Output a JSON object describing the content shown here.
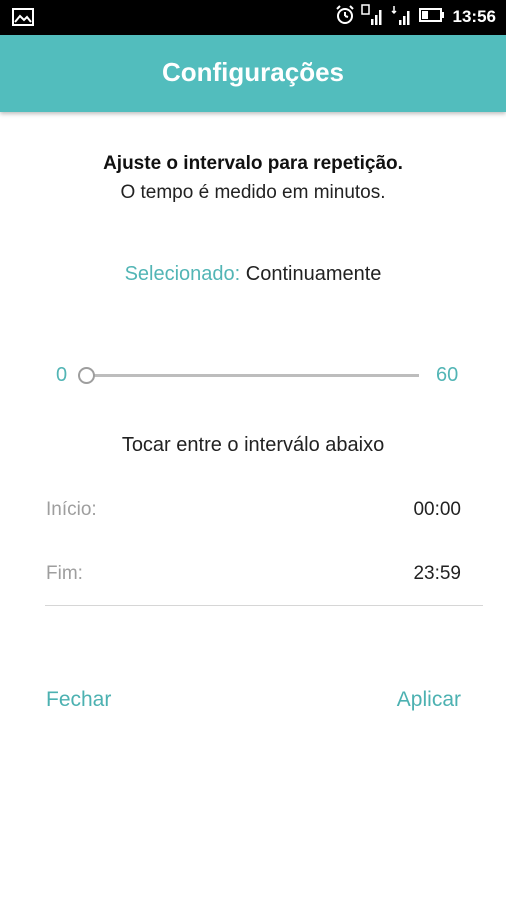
{
  "status_bar": {
    "time": "13:56",
    "icons": [
      "gallery-icon",
      "alarm-icon",
      "signal-icon",
      "data-signal-icon",
      "battery-icon"
    ]
  },
  "app_bar": {
    "title": "Configurações",
    "color": "#52bdbd"
  },
  "intro": {
    "heading": "Ajuste o intervalo para repetição.",
    "subheading": "O tempo é medido em minutos."
  },
  "selection": {
    "label": "Selecionado:",
    "value": "Continuamente"
  },
  "slider": {
    "min_label": "0",
    "max_label": "60",
    "value": 0
  },
  "range": {
    "title": "Tocar entre o interválo abaixo",
    "start_label": "Início:",
    "start_value": "00:00",
    "end_label": "Fim:",
    "end_value": "23:59"
  },
  "actions": {
    "close": "Fechar",
    "apply": "Aplicar"
  },
  "accent_color": "#52b5b5"
}
